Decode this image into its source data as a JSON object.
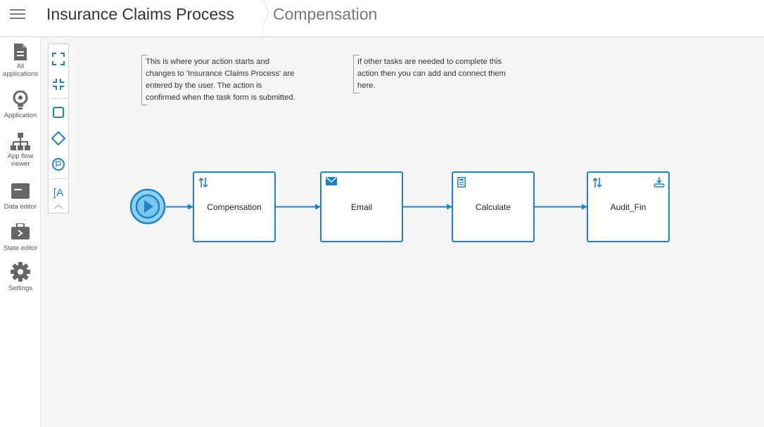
{
  "header": {
    "app_title": "Insurance Claims Process",
    "page_title": "Compensation"
  },
  "sidebar": {
    "items": [
      {
        "line1": "All",
        "line2": "applications",
        "icon": "document-icon"
      },
      {
        "line1": "Application",
        "line2": "",
        "icon": "lightbulb-icon"
      },
      {
        "line1": "App flow",
        "line2": "viewer",
        "icon": "hierarchy-icon"
      },
      {
        "line1": "Data editor",
        "line2": "",
        "icon": "database-icon"
      },
      {
        "line1": "State editor",
        "line2": "",
        "icon": "briefcase-icon"
      },
      {
        "line1": "Settings",
        "line2": "",
        "icon": "gear-icon"
      }
    ]
  },
  "palette": {
    "tools": [
      "expand-icon",
      "collapse-icon",
      "task-square-icon",
      "gateway-diamond-icon",
      "end-event-icon",
      "annotation-text-icon",
      "chevron-up-icon"
    ],
    "annotation_glyph": "[A"
  },
  "annotations": [
    {
      "text": "This is where your action starts and changes to 'Insurance Claims Process' are entered by the user. The action is confirmed when the task form is submitted."
    },
    {
      "text": "If other tasks are needed to complete this action then you can add and connect them here."
    }
  ],
  "flow": {
    "start_event": "play-icon",
    "tasks": [
      {
        "label": "Compensation",
        "icon": "swap-arrows-icon"
      },
      {
        "label": "Email",
        "icon": "envelope-icon"
      },
      {
        "label": "Calculate",
        "icon": "calculator-icon"
      },
      {
        "label": "Audit_Fin",
        "icon": "swap-arrows-icon",
        "icon_right": "download-icon"
      }
    ]
  },
  "colors": {
    "accent": "#1c84c6",
    "start_fill": "#8fd0f5",
    "canvas_bg": "#f5f5f5"
  }
}
